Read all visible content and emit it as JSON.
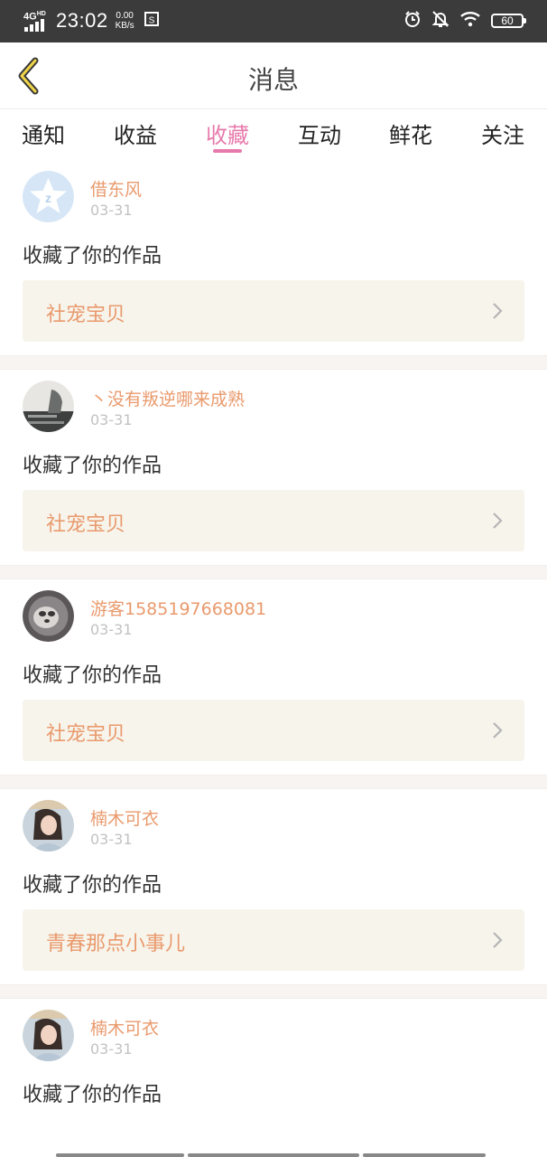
{
  "status_bar": {
    "network": "4G",
    "network_sub": "HD",
    "time": "23:02",
    "speed_value": "0.00",
    "speed_unit": "KB/s",
    "battery": "60"
  },
  "nav": {
    "title": "消息"
  },
  "tabs": [
    {
      "label": "通知",
      "active": false
    },
    {
      "label": "收益",
      "active": false
    },
    {
      "label": "收藏",
      "active": true
    },
    {
      "label": "互动",
      "active": false
    },
    {
      "label": "鲜花",
      "active": false
    },
    {
      "label": "关注",
      "active": false
    }
  ],
  "items": [
    {
      "user": "借东风",
      "date": "03-31",
      "message": "收藏了你的作品",
      "work": "社宠宝贝",
      "avatar": "default-star-avatar"
    },
    {
      "user": "丶没有叛逆哪来成熟",
      "date": "03-31",
      "message": "收藏了你的作品",
      "work": "社宠宝贝",
      "avatar": "photo-avatar"
    },
    {
      "user": "游客1585197668081",
      "date": "03-31",
      "message": "收藏了你的作品",
      "work": "社宠宝贝",
      "avatar": "photo-avatar"
    },
    {
      "user": "楠木可衣",
      "date": "03-31",
      "message": "收藏了你的作品",
      "work": "青春那点小事儿",
      "avatar": "photo-avatar"
    },
    {
      "user": "楠木可衣",
      "date": "03-31",
      "message": "收藏了你的作品",
      "work": "",
      "avatar": "photo-avatar"
    }
  ],
  "colors": {
    "accent": "#e77aac",
    "username": "#e99a6d",
    "card_bg": "#f7f4ec",
    "status_bar": "#3b3b3b"
  }
}
